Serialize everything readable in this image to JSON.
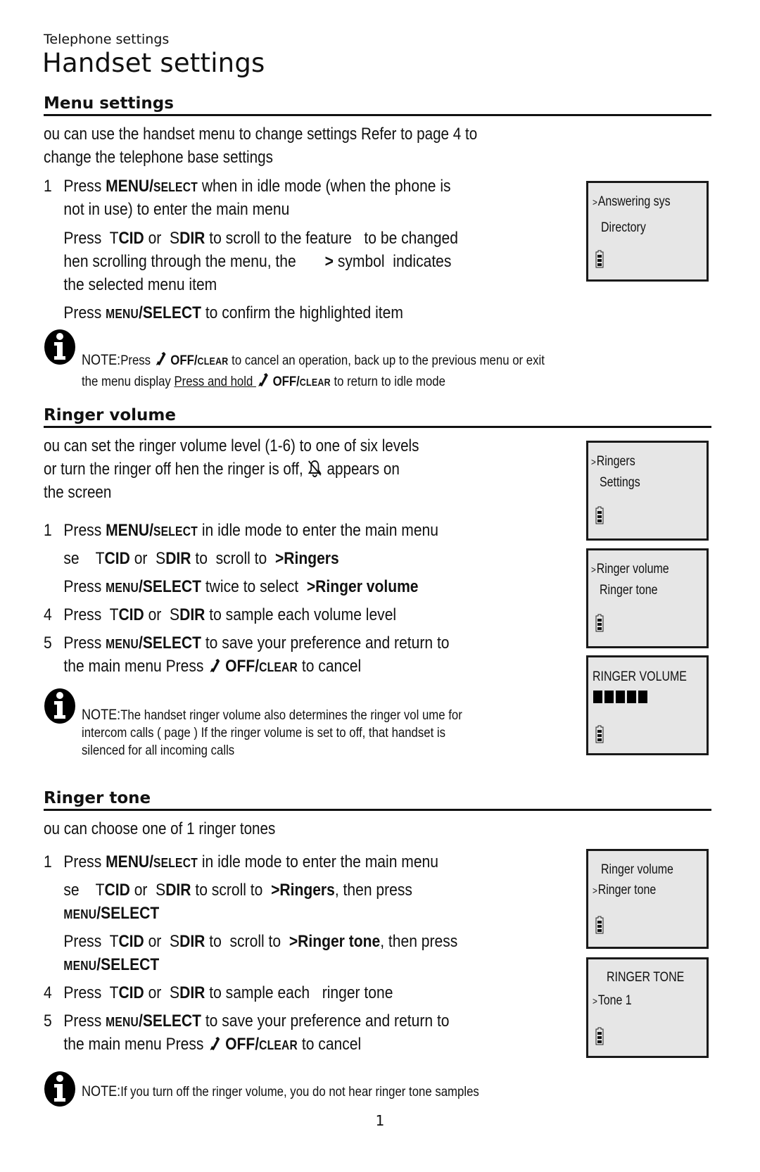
{
  "header": {
    "running_head": "Telephone settings",
    "page_title": "Handset settings"
  },
  "sections": {
    "menu_settings": {
      "heading": "Menu settings",
      "intro_line1": "ou can use the handset menu to change settings       Refer to  page 4    to",
      "intro_line2": "change the telephone base settings",
      "steps": [
        {
          "num": "1",
          "parts": [
            {
              "t": "Press ",
              "s": "n"
            },
            {
              "t": "MENU/",
              "s": "b"
            },
            {
              "t": "SELECT",
              "s": "sc"
            },
            {
              "t": " when in idle mode (when the phone is",
              "s": "n"
            }
          ],
          "line2": "not in use) to enter the main menu"
        },
        {
          "num": "",
          "parts": [
            {
              "t": "Press  ",
              "s": "n"
            },
            {
              "t": "T",
              "s": "n"
            },
            {
              "t": "CID",
              "s": "b"
            },
            {
              "t": " or  ",
              "s": "n"
            },
            {
              "t": "S",
              "s": "n"
            },
            {
              "t": "DIR",
              "s": "b"
            },
            {
              "t": " to scroll to the feature   to be changed",
              "s": "n"
            }
          ],
          "line2_parts": [
            {
              "t": "hen scrolling through the menu, the       ",
              "s": "n"
            },
            {
              "t": ">",
              "s": "b"
            },
            {
              "t": " symbol  indicates",
              "s": "n"
            }
          ],
          "line3": "the selected  menu item"
        },
        {
          "num": "",
          "parts": [
            {
              "t": "Press ",
              "s": "n"
            },
            {
              "t": "MENU",
              "s": "sc"
            },
            {
              "t": "/SELECT",
              "s": "b"
            },
            {
              "t": " to confirm the highlighted item",
              "s": "n"
            }
          ]
        }
      ],
      "note": {
        "label": "NOTE:",
        "line1_a": "Press ",
        "key": "OFF/",
        "key_sc": "CLEAR",
        "line1_b": " to cancel an operation, back up to the previous menu or exit",
        "line2_a": "the menu display  ",
        "line2_link": "Press and hold ",
        "line2_b": " to return to idle mode"
      },
      "lcd": {
        "lines": [
          {
            "caret": ">",
            "text": "Answering sys"
          },
          {
            "caret": "",
            "text": "Directory"
          }
        ],
        "battery_icon": "battery-icon"
      }
    },
    "ringer_volume": {
      "heading": "Ringer volume",
      "intro_line1": "ou can set the ringer volume level (1-6)      to one of six levels",
      "intro_line2a": "or turn the ringer off hen the ringer is off,        ",
      "intro_line2b": " appears on",
      "intro_line3": "the screen",
      "ringer_off_icon": "ringer-off-bell-icon",
      "steps": [
        {
          "num": "1",
          "parts": [
            {
              "t": "Press ",
              "s": "n"
            },
            {
              "t": "MENU/",
              "s": "b"
            },
            {
              "t": "SELECT",
              "s": "sc"
            },
            {
              "t": " in idle mode to enter the main menu",
              "s": "n"
            }
          ]
        },
        {
          "num": "",
          "parts": [
            {
              "t": "se    ",
              "s": "n"
            },
            {
              "t": "T",
              "s": "n"
            },
            {
              "t": "CID",
              "s": "b"
            },
            {
              "t": " or  ",
              "s": "n"
            },
            {
              "t": "S",
              "s": "n"
            },
            {
              "t": "DIR",
              "s": "b"
            },
            {
              "t": " to  scroll to  ",
              "s": "n"
            },
            {
              "t": ">Ringers",
              "s": "b"
            }
          ]
        },
        {
          "num": "",
          "parts": [
            {
              "t": "Press ",
              "s": "n"
            },
            {
              "t": "MENU",
              "s": "sc"
            },
            {
              "t": "/SELECT",
              "s": "b"
            },
            {
              "t": " twice to select  ",
              "s": "n"
            },
            {
              "t": ">Ringer volume",
              "s": "b"
            }
          ]
        },
        {
          "num": "4",
          "parts": [
            {
              "t": "Press  ",
              "s": "n"
            },
            {
              "t": "T",
              "s": "n"
            },
            {
              "t": "CID",
              "s": "b"
            },
            {
              "t": " or  ",
              "s": "n"
            },
            {
              "t": "S",
              "s": "n"
            },
            {
              "t": "DIR",
              "s": "b"
            },
            {
              "t": " to sample each volume level",
              "s": "n"
            }
          ]
        },
        {
          "num": "5",
          "parts": [
            {
              "t": "Press ",
              "s": "n"
            },
            {
              "t": "MENU",
              "s": "sc"
            },
            {
              "t": "/SELECT",
              "s": "b"
            },
            {
              "t": " to save your preference and return to",
              "s": "n"
            }
          ],
          "line2_a": "the main menu   Press ",
          "line2_key": "OFF/",
          "line2_key_sc": "CLEAR",
          "line2_b": " to  cancel"
        }
      ],
      "note": {
        "label": "NOTE:",
        "line1": "The handset ringer volume also determines the ringer vol    ume for",
        "line2": "intercom  calls ( page      ) If the ringer volume is set to off, that handset is",
        "line3": "silenced for all incoming calls"
      },
      "lcd_ringers": {
        "lines": [
          {
            "caret": ">",
            "text": "Ringers"
          },
          {
            "caret": "",
            "text": "Settings"
          }
        ]
      },
      "lcd_ringer_menu": {
        "lines": [
          {
            "caret": ">",
            "text": "Ringer volume"
          },
          {
            "caret": "",
            "text": "Ringer tone"
          }
        ]
      },
      "lcd_volume": {
        "title": "RINGER VOLUME",
        "level": 5,
        "max_level": 6
      }
    },
    "ringer_tone": {
      "heading": "Ringer tone",
      "intro": "ou can   choose one of 1 ringer tones",
      "steps": [
        {
          "num": "1",
          "parts": [
            {
              "t": "Press ",
              "s": "n"
            },
            {
              "t": "MENU/",
              "s": "b"
            },
            {
              "t": "SELECT",
              "s": "sc"
            },
            {
              "t": " in idle mode to enter the main menu",
              "s": "n"
            }
          ]
        },
        {
          "num": "",
          "parts": [
            {
              "t": "se    ",
              "s": "n"
            },
            {
              "t": "T",
              "s": "n"
            },
            {
              "t": "CID",
              "s": "b"
            },
            {
              "t": " or  ",
              "s": "n"
            },
            {
              "t": "S",
              "s": "n"
            },
            {
              "t": "DIR",
              "s": "b"
            },
            {
              "t": " to scroll to  ",
              "s": "n"
            },
            {
              "t": ">Ringers",
              "s": "b"
            },
            {
              "t": ", then press",
              "s": "n"
            }
          ],
          "line2_sc": "MENU",
          "line2_b": "/SELECT"
        },
        {
          "num": "",
          "parts": [
            {
              "t": "Press  ",
              "s": "n"
            },
            {
              "t": "T",
              "s": "n"
            },
            {
              "t": "CID",
              "s": "b"
            },
            {
              "t": " or  ",
              "s": "n"
            },
            {
              "t": "S",
              "s": "n"
            },
            {
              "t": "DIR",
              "s": "b"
            },
            {
              "t": " to  scroll to  ",
              "s": "n"
            },
            {
              "t": ">Ringer tone",
              "s": "b"
            },
            {
              "t": ", then press",
              "s": "n"
            }
          ],
          "line2_sc": "MENU",
          "line2_b": "/SELECT"
        },
        {
          "num": "4",
          "parts": [
            {
              "t": "Press  ",
              "s": "n"
            },
            {
              "t": "T",
              "s": "n"
            },
            {
              "t": "CID",
              "s": "b"
            },
            {
              "t": " or  ",
              "s": "n"
            },
            {
              "t": "S",
              "s": "n"
            },
            {
              "t": "DIR",
              "s": "b"
            },
            {
              "t": " to sample each   ringer tone",
              "s": "n"
            }
          ]
        },
        {
          "num": "5",
          "parts": [
            {
              "t": "Press ",
              "s": "n"
            },
            {
              "t": "MENU",
              "s": "sc"
            },
            {
              "t": "/SELECT",
              "s": "b"
            },
            {
              "t": " to save your preference and return to",
              "s": "n"
            }
          ],
          "line2_a": "the main menu   Press ",
          "line2_key": "OFF/",
          "line2_key_sc": "CLEAR",
          "line2_b": " to  cancel"
        }
      ],
      "note": {
        "label": "NOTE:",
        "line1": "If you turn off the ringer volume, you do not hear ringer tone samples"
      },
      "lcd_ringer_menu": {
        "lines": [
          {
            "caret": "",
            "text": "Ringer volume"
          },
          {
            "caret": ">",
            "text": "Ringer tone"
          }
        ]
      },
      "lcd_tone": {
        "title": "RINGER TONE",
        "lines": [
          {
            "caret": ">",
            "text": "Tone 1"
          }
        ]
      }
    }
  },
  "footer": {
    "page_number": "1"
  }
}
